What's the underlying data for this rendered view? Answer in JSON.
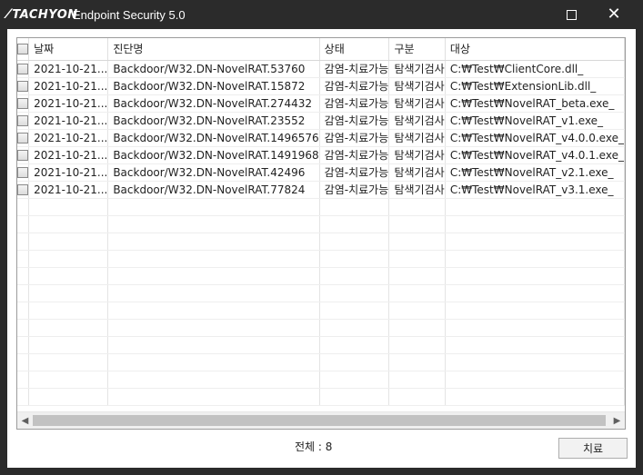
{
  "window": {
    "logo_text": "TACHYON",
    "title": "Endpoint Security 5.0"
  },
  "table": {
    "headers": [
      "날짜",
      "진단명",
      "상태",
      "구분",
      "대상"
    ],
    "rows": [
      [
        "2021-10-21...",
        "Backdoor/W32.DN-NovelRAT.53760",
        "감염-치료가능",
        "탐색기검사",
        "C:₩Test₩ClientCore.dll_"
      ],
      [
        "2021-10-21...",
        "Backdoor/W32.DN-NovelRAT.15872",
        "감염-치료가능",
        "탐색기검사",
        "C:₩Test₩ExtensionLib.dll_"
      ],
      [
        "2021-10-21...",
        "Backdoor/W32.DN-NovelRAT.274432",
        "감염-치료가능",
        "탐색기검사",
        "C:₩Test₩NovelRAT_beta.exe_"
      ],
      [
        "2021-10-21...",
        "Backdoor/W32.DN-NovelRAT.23552",
        "감염-치료가능",
        "탐색기검사",
        "C:₩Test₩NovelRAT_v1.exe_"
      ],
      [
        "2021-10-21...",
        "Backdoor/W32.DN-NovelRAT.1496576",
        "감염-치료가능",
        "탐색기검사",
        "C:₩Test₩NovelRAT_v4.0.0.exe_"
      ],
      [
        "2021-10-21...",
        "Backdoor/W32.DN-NovelRAT.1491968",
        "감염-치료가능",
        "탐색기검사",
        "C:₩Test₩NovelRAT_v4.0.1.exe_"
      ],
      [
        "2021-10-21...",
        "Backdoor/W32.DN-NovelRAT.42496",
        "감염-치료가능",
        "탐색기검사",
        "C:₩Test₩NovelRAT_v2.1.exe_"
      ],
      [
        "2021-10-21...",
        "Backdoor/W32.DN-NovelRAT.77824",
        "감염-치료가능",
        "탐색기검사",
        "C:₩Test₩NovelRAT_v3.1.exe_"
      ]
    ]
  },
  "footer": {
    "total_label": "전체 : 8",
    "cure_button": "치료"
  },
  "colors": {
    "titlebar": "#2b2b2b",
    "client_bg": "#ffffff",
    "scroll_thumb": "#c2c2c2"
  },
  "icons": {
    "maximize": "maximize-icon",
    "close": "close-icon",
    "scroll_left": "scroll-left-icon",
    "scroll_right": "scroll-right-icon"
  }
}
